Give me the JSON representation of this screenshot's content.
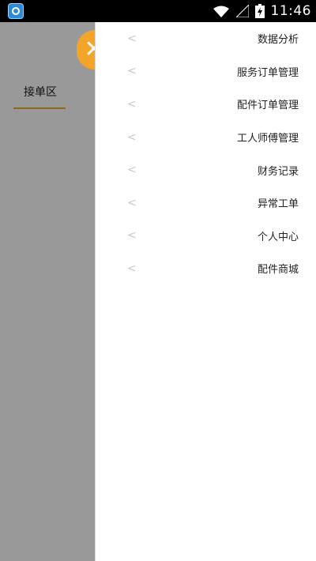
{
  "status_bar": {
    "time": "11:46"
  },
  "left_panel": {
    "tab": "接单区"
  },
  "menu": {
    "items": [
      {
        "label": "数据分析"
      },
      {
        "label": "服务订单管理"
      },
      {
        "label": "配件订单管理"
      },
      {
        "label": "工人师傅管理"
      },
      {
        "label": "财务记录"
      },
      {
        "label": "异常工单"
      },
      {
        "label": "个人中心"
      },
      {
        "label": "配件商城"
      }
    ]
  },
  "colors": {
    "accent_orange": "#f3a52a",
    "underline_brown": "#8c6a16",
    "scrim_gray": "#999999"
  },
  "icons": [
    "app-launcher-icon",
    "wifi-icon",
    "signal-icon",
    "battery-icon",
    "close-icon",
    "chevron-left-icon"
  ]
}
